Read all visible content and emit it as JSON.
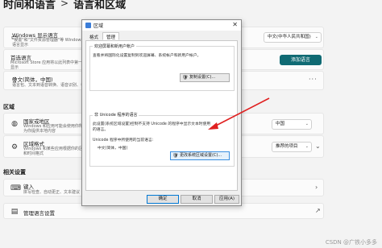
{
  "breadcrumb": {
    "parent": "时间和语言",
    "separator": ">",
    "current": "语言和区域"
  },
  "windows_display_language": {
    "title": "Windows 显示语言",
    "desc1": "\"设置\"和\"文件资源管理器\"等 Windows 功能将使用此",
    "desc2": "语言显示",
    "value": "中文(中华人民共和国)"
  },
  "preferred_languages": {
    "title": "首选语言",
    "desc1": "Microsoft Store 应用将以此列表中第一个受支持的语言",
    "desc2": "显示",
    "add_button": "添加语言"
  },
  "language_item": {
    "title": "中文(简体，中国)",
    "desc": "语言包、文本到语音转换、语音识别、手写、基本键入"
  },
  "region_section": {
    "title": "区域",
    "country": {
      "title": "国家或地区",
      "desc1": "Windows 和应用可能会使用你所在的国家或地区",
      "desc2": "为你提供本地内容",
      "value": "中国"
    },
    "format": {
      "title": "区域格式",
      "desc1": "Windows 和某些应用根据你的区域格式设置日期",
      "desc2": "和时间格式",
      "value": "推荐的项目"
    }
  },
  "related_section": {
    "title": "相关设置",
    "typing": {
      "title": "键入",
      "desc": "拼写检查、自动更正、文本建议"
    },
    "admin": {
      "title": "管理语言设置"
    }
  },
  "dialog": {
    "title": "区域",
    "close": "✕",
    "tabs": [
      "格式",
      "管理"
    ],
    "welcome": {
      "title": "欢迎屏幕和新用户帐户",
      "text": "查看并将国际化设置复制到欢迎屏幕、系统帐户和新用户帐户。",
      "button": "复制设置(C)..."
    },
    "unicode": {
      "title": "非 Unicode 程序的语言",
      "text1": "此设置(系统区域设置)控制不支持 Unicode 的程序中显示文本时使用",
      "text2": "的语言。",
      "current_label": "Unicode 程序中所使用的当前语言:",
      "current_value": "中文(简体，中国)",
      "button": "更改系统区域设置(C)..."
    },
    "ok": "确定",
    "cancel": "取消",
    "apply": "应用(A)"
  },
  "watermark": "CSDN @广铁小多多",
  "colors": {
    "accent": "#0f6a73",
    "arrow": "#e02020",
    "focus": "#3a8fe0"
  },
  "icons": [
    "display-icon",
    "globe-icon",
    "region-format-icon",
    "keyboard-icon",
    "language-settings-icon",
    "shield-icon"
  ]
}
